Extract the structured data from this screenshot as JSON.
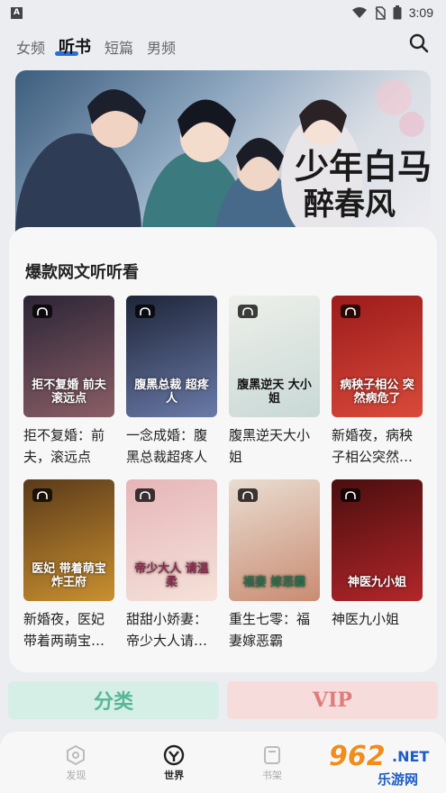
{
  "status_bar": {
    "badge": "A",
    "time": "3:09"
  },
  "top_tabs": [
    {
      "label": "女频",
      "active": false
    },
    {
      "label": "听书",
      "active": true
    },
    {
      "label": "短篇",
      "active": false
    },
    {
      "label": "男频",
      "active": false
    }
  ],
  "banner": {
    "calligraphy_line1": "少年白马",
    "calligraphy_line2": "醉春风"
  },
  "section": {
    "title": "爆款网文听听看"
  },
  "books": [
    {
      "name": "拒不复婚：前夫，滚远点",
      "cover_title": "拒不复婚 前夫滚远点",
      "color1": "#2b2536",
      "color2": "#8b5e66"
    },
    {
      "name": "一念成婚：腹黑总裁超疼人",
      "cover_title": "腹黑总裁 超疼人",
      "color1": "#1e2538",
      "color2": "#6a7aa8"
    },
    {
      "name": "腹黑逆天大小姐",
      "cover_title": "腹黑逆天 大小姐",
      "color1": "#eef0ea",
      "color2": "#c9d8d6"
    },
    {
      "name": "新婚夜，病秧子相公突然…",
      "cover_title": "病秧子相公 突然病危了",
      "color1": "#9c1b1b",
      "color2": "#d94a3a"
    },
    {
      "name": "新婚夜，医妃带着两萌宝…",
      "cover_title": "医妃 带着萌宝 炸王府",
      "color1": "#5a3a1a",
      "color2": "#c9902f"
    },
    {
      "name": "甜甜小娇妻：帝少大人请…",
      "cover_title": "帝少大人 请温柔",
      "color1": "#e6b5b8",
      "color2": "#f5e2d9"
    },
    {
      "name": "重生七零：福妻嫁恶霸",
      "cover_title": "福妻 嫁恶霸",
      "color1": "#e9ddd2",
      "color2": "#c98c72"
    },
    {
      "name": "神医九小姐",
      "cover_title": "神医九小姐",
      "color1": "#4a0e0e",
      "color2": "#b3262a"
    }
  ],
  "buttons": {
    "category": "分类",
    "vip": "VIP"
  },
  "bottom_nav": [
    {
      "label": "发现",
      "active": false
    },
    {
      "label": "世界",
      "active": true
    },
    {
      "label": "书架",
      "active": false
    }
  ],
  "watermark": {
    "num": "962",
    "net": ".NET",
    "sub": "乐游网"
  },
  "colors": {
    "accent_blue": "#2a6fd6",
    "category_bg": "#d5efe6",
    "category_text": "#58b796",
    "vip_bg": "#f7dcdc",
    "vip_text": "#e07b7b"
  }
}
